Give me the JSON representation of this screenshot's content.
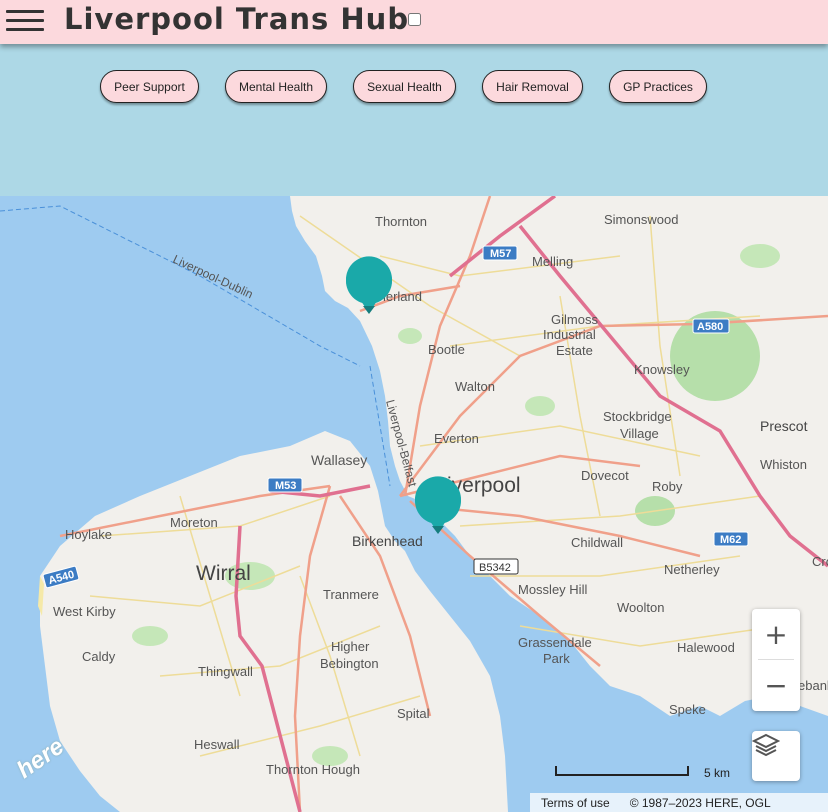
{
  "header": {
    "title": "Liverpool Trans Hub"
  },
  "filters": [
    {
      "label": "Peer Support"
    },
    {
      "label": "Mental Health"
    },
    {
      "label": "Sexual Health"
    },
    {
      "label": "Hair Removal"
    },
    {
      "label": "GP Practices"
    }
  ],
  "map": {
    "places": {
      "thornton": "Thornton",
      "simonswood": "Simonswood",
      "melling": "Melling",
      "litherland": "therland",
      "gilmoss1": "Gilmoss",
      "gilmoss2": "Industrial",
      "gilmoss3": "Estate",
      "bootle": "Bootle",
      "knowsley": "Knowsley",
      "walton": "Walton",
      "stockbridge1": "Stockbridge",
      "stockbridge2": "Village",
      "prescot": "Prescot",
      "everton": "Everton",
      "wallasey": "Wallasey",
      "liverpool": "iverpool",
      "dovecot": "Dovecot",
      "roby": "Roby",
      "whiston": "Whiston",
      "moreton": "Moreton",
      "hoylake": "Hoylake",
      "birkenhead": "Birkenhead",
      "childwall": "Childwall",
      "wirral": "Wirral",
      "netherley": "Netherley",
      "westkirby": "West Kirby",
      "tranmere": "Tranmere",
      "mossleyhill": "Mossley Hill",
      "woolton": "Woolton",
      "caldy": "Caldy",
      "higherbeb1": "Higher",
      "higherbeb2": "Bebington",
      "grassendale1": "Grassendale",
      "grassendale2": "Park",
      "halewood": "Halewood",
      "thingwall": "Thingwall",
      "heswall": "Heswall",
      "spital": "Spital",
      "speke": "Speke",
      "thorntonhough": "Thornton Hough",
      "hebank": "ebank",
      "cro": "Cro"
    },
    "water_labels": {
      "liverpool_dublin": "Liverpool-Dublin",
      "liverpool_belfast": "Liverpool-Belfast"
    },
    "road_shields": {
      "m57": "M57",
      "a580": "A580",
      "m53": "M53",
      "m62": "M62",
      "a540": "A540",
      "b5342": "B5342"
    },
    "markers": [
      {
        "name": "north"
      },
      {
        "name": "city-centre"
      }
    ],
    "scale_label": "5 km",
    "attribution": {
      "terms": "Terms of use",
      "copyright": "© 1987–2023 HERE, OGL"
    },
    "logo_text": "here",
    "colors": {
      "header_bg": "#fcd9dd",
      "page_bg": "#add8e6",
      "marker": "#1aa9a9",
      "water": "#9ecbf0",
      "land": "#f2f0ec",
      "motorway": "#e07090",
      "a_road": "#f0a08a"
    }
  }
}
